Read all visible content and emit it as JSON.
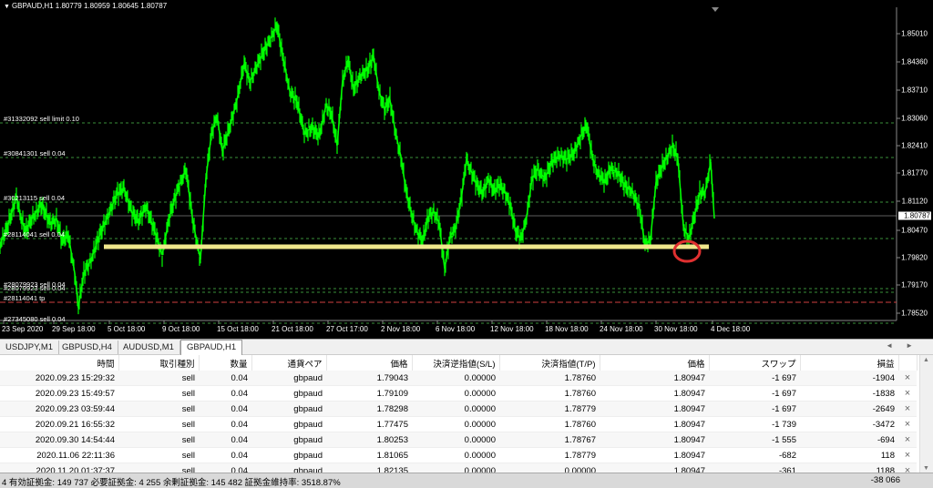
{
  "chart": {
    "symbol_info": "GBPAUD,H1  1.80779 1.80959 1.80645 1.80787",
    "current_price": "1.80787",
    "price_axis": [
      "1.85010",
      "1.84360",
      "1.83710",
      "1.83060",
      "1.82410",
      "1.81770",
      "1.81120",
      "1.80470",
      "1.79820",
      "1.79170",
      "1.78520"
    ],
    "time_axis": [
      "23 Sep 2020",
      "29 Sep 18:00",
      "5 Oct 18:00",
      "9 Oct 18:00",
      "15 Oct 18:00",
      "21 Oct 18:00",
      "27 Oct 17:00",
      "2 Nov 18:00",
      "6 Nov 18:00",
      "12 Nov 18:00",
      "18 Nov 18:00",
      "24 Nov 18:00",
      "30 Nov 18:00",
      "4 Dec 18:00"
    ],
    "order_lines": [
      {
        "label": "#31332092 sell limit 0.10",
        "color": "#3a8f3a"
      },
      {
        "label": "#30841301 sell 0.04",
        "color": "#3a8f3a"
      },
      {
        "label": "#30213115 sell 0.04",
        "color": "#3a8f3a"
      },
      {
        "label": "#28114041 sell 0.04",
        "color": "#3a8f3a"
      },
      {
        "label": "#28079923 sell 0.04",
        "color": "#3a8f3a"
      },
      {
        "label": "#28079923 sell 0.04",
        "color": "#3a8f3a"
      },
      {
        "label": "#28114041 tp",
        "color": "#d04040"
      },
      {
        "label": "#27345080 sell 0.04",
        "color": "#3a8f3a"
      }
    ],
    "colors": {
      "background": "#000000",
      "candles": "#00ff00",
      "support_line": "#f0e68c",
      "highlight_circle": "#e03030"
    }
  },
  "tabs": [
    {
      "label": "USDJPY,M1",
      "active": false
    },
    {
      "label": "GBPUSD,H4",
      "active": false
    },
    {
      "label": "AUDUSD,M1",
      "active": false
    },
    {
      "label": "GBPAUD,H1",
      "active": true
    }
  ],
  "table": {
    "headers": [
      "時間",
      "取引種別",
      "数量",
      "通貨ペア",
      "価格",
      "決済逆指値(S/L)",
      "決済指値(T/P)",
      "価格",
      "スワップ",
      "損益"
    ],
    "rows": [
      [
        "2020.09.23 15:29:32",
        "sell",
        "0.04",
        "gbpaud",
        "1.79043",
        "0.00000",
        "1.78760",
        "1.80947",
        "-1 697",
        "-1904"
      ],
      [
        "2020.09.23 15:49:57",
        "sell",
        "0.04",
        "gbpaud",
        "1.79109",
        "0.00000",
        "1.78760",
        "1.80947",
        "-1 697",
        "-1838"
      ],
      [
        "2020.09.23 03:59:44",
        "sell",
        "0.04",
        "gbpaud",
        "1.78298",
        "0.00000",
        "1.78779",
        "1.80947",
        "-1 697",
        "-2649"
      ],
      [
        "2020.09.21 16:55:32",
        "sell",
        "0.04",
        "gbpaud",
        "1.77475",
        "0.00000",
        "1.78760",
        "1.80947",
        "-1 739",
        "-3472"
      ],
      [
        "2020.09.30 14:54:44",
        "sell",
        "0.04",
        "gbpaud",
        "1.80253",
        "0.00000",
        "1.78767",
        "1.80947",
        "-1 555",
        "-694"
      ],
      [
        "2020.11.06 22:11:36",
        "sell",
        "0.04",
        "gbpaud",
        "1.81065",
        "0.00000",
        "1.78779",
        "1.80947",
        "-682",
        "118"
      ],
      [
        "2020.11.20 01:37:37",
        "sell",
        "0.04",
        "gbpaud",
        "1.82135",
        "0.00000",
        "0.00000",
        "1.80947",
        "-361",
        "1188"
      ]
    ],
    "close_icon": "×"
  },
  "status": {
    "text": "4  有効証拠金: 149 737  必要証拠金: 4 255  余剰証拠金: 145 482  証拠金維持率: 3518.87%",
    "total": "-38 066"
  }
}
